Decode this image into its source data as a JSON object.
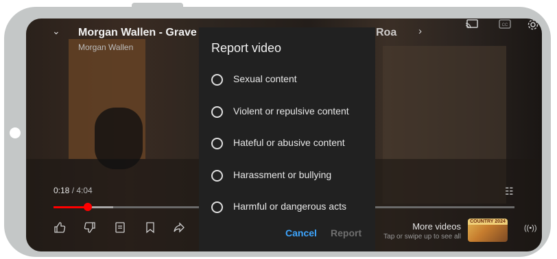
{
  "player": {
    "video_title": "Morgan Wallen - Grave",
    "title_tail": "Roa",
    "channel": "Morgan Wallen",
    "time_current": "0:18",
    "time_separator": " / ",
    "time_total": "4:04",
    "progress_fraction": 0.074,
    "buffer_fraction": 0.13,
    "more_videos_title": "More videos",
    "more_videos_subtitle": "Tap or swipe up to see all",
    "thumbnail_badge": "COUNTRY 2024"
  },
  "icons": {
    "top": [
      "cast-icon",
      "captions-icon",
      "settings-icon"
    ],
    "actions": [
      "like-icon",
      "dislike-icon",
      "comments-icon",
      "save-icon",
      "share-icon"
    ]
  },
  "dialog": {
    "title": "Report video",
    "options": [
      {
        "label": "Sexual content"
      },
      {
        "label": "Violent or repulsive content"
      },
      {
        "label": "Hateful or abusive content"
      },
      {
        "label": "Harassment or bullying"
      },
      {
        "label": "Harmful or dangerous acts"
      }
    ],
    "cancel_label": "Cancel",
    "report_label": "Report"
  },
  "colors": {
    "accent_blue": "#3ea6ff",
    "progress_red": "#ff0000",
    "dialog_bg": "#212121",
    "frame": "#c4c7c7"
  }
}
